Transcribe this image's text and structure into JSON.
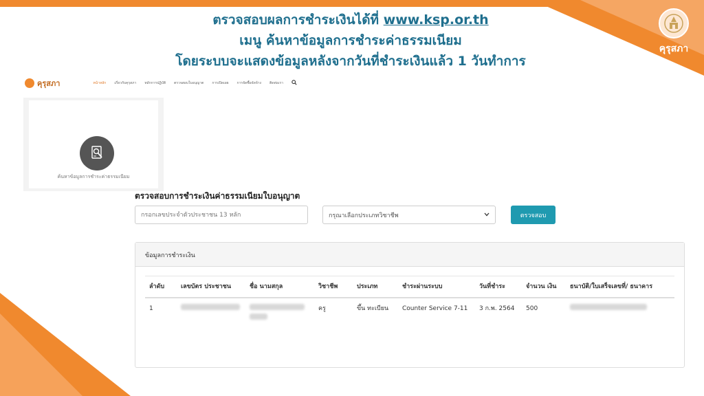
{
  "announcement": {
    "line1_prefix": "ตรวจสอบผลการชำระเงินได้ที่ ",
    "line1_url": "www.ksp.or.th",
    "line2": "เมนู ค้นหาข้อมูลการชำระค่าธรรมเนียม",
    "line3": "โดยระบบจะแสดงข้อมูลหลังจากวันที่ชำระเงินแล้ว 1 วันทำการ"
  },
  "brand": {
    "name": "คุรุสภา",
    "accent": "#f0892e",
    "primary_text": "#1f6f8e",
    "button_color": "#1f9ab0"
  },
  "site_nav": {
    "logo_text": "คุรุสภา",
    "items": [
      "หน้าหลัก",
      "เกี่ยวกับคุรุสภา",
      "หลักการปฏิบัติ",
      "ตรวจสอบใบอนุญาต",
      "การเปิดเผย",
      "การจัดซื้อจัดจ้าง",
      "ติดต่อเรา"
    ],
    "search_icon": "search-icon"
  },
  "tile": {
    "label": "ค้นหาข้อมูลการชำระค่าธรรมเนียม",
    "icon": "document-search-icon"
  },
  "form": {
    "title": "ตรวจสอบการชำระเงินค่าธรรมเนียมใบอนุญาต",
    "id_placeholder": "กรอกเลขประจำตัวประชาชน 13 หลัก",
    "profession_select": "กรุณาเลือกประเภทวิชาชีพ",
    "submit_label": "ตรวจสอบ"
  },
  "results": {
    "card_title": "ข้อมูลการชำระเงิน",
    "columns": [
      "ลำดับ",
      "เลขบัตร ประชาชน",
      "ชื่อ นามสกุล",
      "วิชาชีพ",
      "ประเภท",
      "ชำระผ่านระบบ",
      "วันที่ชำระ",
      "จำนวน เงิน",
      "ธนาบัติ/ใบเสร็จเลขที่/ ธนาคาร"
    ],
    "rows": [
      {
        "index": "1",
        "profession": "ครู",
        "type": "ขึ้น ทะเบียน",
        "channel": "Counter Service 7-11",
        "date": "3 ก.พ. 2564",
        "amount": "500"
      }
    ]
  }
}
